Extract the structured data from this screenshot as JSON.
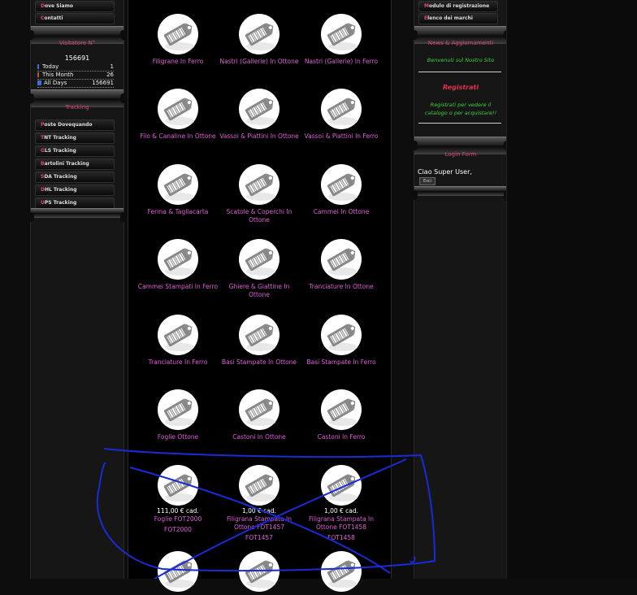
{
  "left_menu_top": [
    {
      "first": "D",
      "rest": "ove Siamo"
    },
    {
      "first": "C",
      "rest": "ontatti"
    }
  ],
  "visitor_box": {
    "title": "Visitatore N°",
    "total": "156691",
    "rows": [
      {
        "label": "Today",
        "value": "1",
        "color": "#3b6fd0"
      },
      {
        "label": "This Month",
        "value": "26",
        "color": "#3b6fd0"
      },
      {
        "label": "All Days",
        "value": "156691",
        "color": "#3b6fd0"
      }
    ]
  },
  "tracking_box": {
    "title": "Tracking",
    "items": [
      {
        "first": "P",
        "rest": "oste Dovequando"
      },
      {
        "first": "T",
        "rest": "NT Tracking"
      },
      {
        "first": "G",
        "rest": "LS Tracking"
      },
      {
        "first": "B",
        "rest": "artolini Tracking"
      },
      {
        "first": "S",
        "rest": "DA Tracking"
      },
      {
        "first": "D",
        "rest": "HL Tracking"
      },
      {
        "first": "U",
        "rest": "PS Tracking"
      }
    ]
  },
  "products": [
    {
      "name": "Filigrane In Ferro"
    },
    {
      "name": "Nastri (Gallerie) In Ottone"
    },
    {
      "name": "Nastri (Gallerie) In Ferro"
    },
    {
      "name": "Filo & Canaline In Ottone"
    },
    {
      "name": "Vassoi & Piattini In Ottone"
    },
    {
      "name": "Vassoi & Piattini In Ferro"
    },
    {
      "name": "Ferma & Tagliacarta"
    },
    {
      "name": "Scatole & Coperchi In Ottone"
    },
    {
      "name": "Cammei In Ottone"
    },
    {
      "name": "Cammei Stampati In Ferro"
    },
    {
      "name": "Ghiere & Giattine In Ottone"
    },
    {
      "name": "Tranciature In Ottone"
    },
    {
      "name": "Tranciature In Ferro"
    },
    {
      "name": "Basi Stampate In Ottone"
    },
    {
      "name": "Basi Stampate In Ferro"
    },
    {
      "name": "Foglie Ottone"
    },
    {
      "name": "Castoni In Ottone"
    },
    {
      "name": "Castoni In Ferro"
    }
  ],
  "priced_products": [
    {
      "price": "111,00 € cad.",
      "name": "Foglie FOT2000",
      "code": "FOT2000"
    },
    {
      "price": "1,00 € cad.",
      "name": "Filigrana Stampata In Ottone FOT1457",
      "code": "FOT1457"
    },
    {
      "price": "1,00 € cad.",
      "name": "Filigrana Stampata In Ottone FOT1458",
      "code": "FOT1458"
    }
  ],
  "right_menu_top": [
    {
      "first": "M",
      "rest": "odulo di registrazione"
    },
    {
      "first": "E",
      "rest": "lenco dei marchi"
    }
  ],
  "news_box": {
    "title": "News & Aggiornamenti",
    "welcome": "Benvenuti sul Nostro Sito",
    "register_title": "Registrati",
    "register_text": "Registrati per vedere il catalogo o per acquistare!!"
  },
  "login_box": {
    "title": "Login Form",
    "greeting": "Ciao Super User,",
    "button": "Esci"
  },
  "colors": {
    "accent": "#d8476c",
    "link": "#e05fd8",
    "green": "#3bd13b",
    "scribble": "#1a2bd6"
  }
}
